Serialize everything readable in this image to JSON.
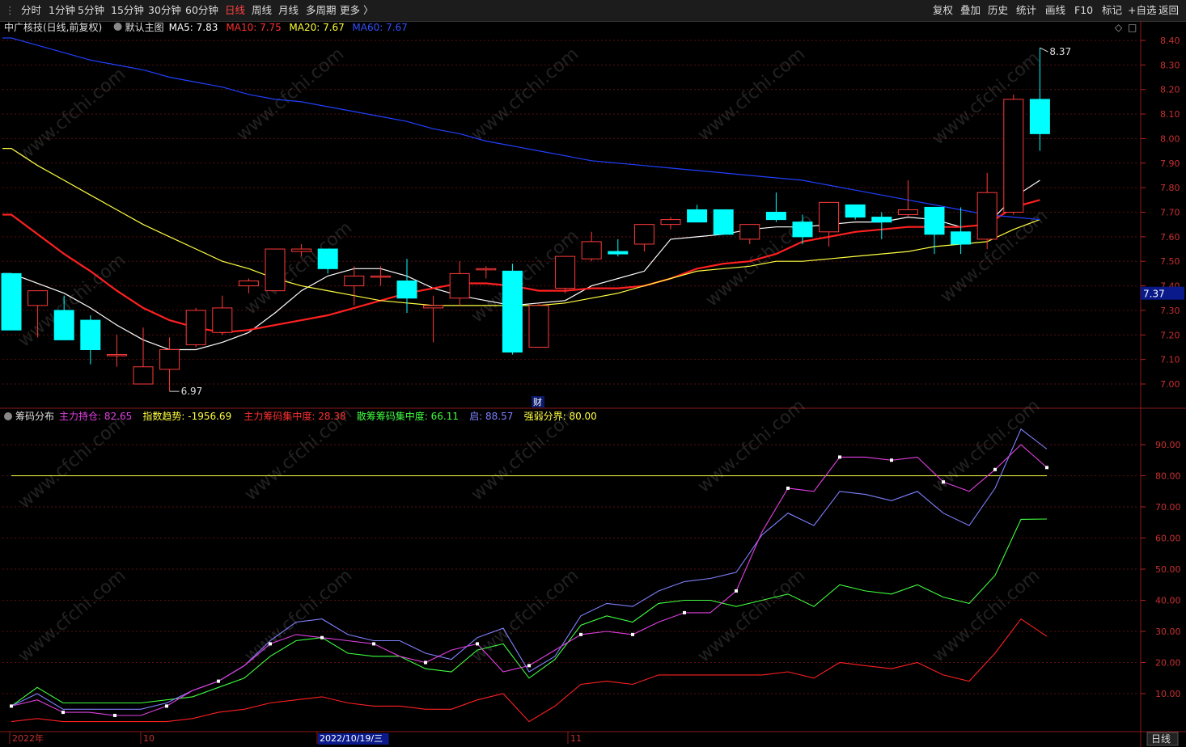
{
  "toolbar": {
    "left": [
      "分时",
      "1分钟",
      "5分钟",
      "15分钟",
      "30分钟",
      "60分钟",
      "日线",
      "周线",
      "月线",
      "多周期",
      "更多 〉"
    ],
    "active": "日线",
    "right": [
      "复权",
      "叠加",
      "历史",
      "统计",
      "画线",
      "F10",
      "标记",
      "+自选",
      "返回"
    ]
  },
  "main_panel": {
    "stock": "中广核技(日线,前复权)",
    "template": "默认主图",
    "ma": [
      {
        "label": "MA5: 7.83",
        "color": "#ffffff"
      },
      {
        "label": "MA10: 7.75",
        "color": "#ff3030"
      },
      {
        "label": "MA20: 7.67",
        "color": "#ffff33"
      },
      {
        "label": "MA60: 7.67",
        "color": "#3050ff"
      }
    ],
    "yticks": [
      "8.40",
      "8.30",
      "8.20",
      "8.10",
      "8.00",
      "7.90",
      "7.80",
      "7.70",
      "7.60",
      "7.50",
      "7.40",
      "7.30",
      "7.20",
      "7.10",
      "7.00"
    ],
    "price_tag": "7.37",
    "high_label": "8.37",
    "low_label": "6.97",
    "cai_marker": "财"
  },
  "indicator_panel": {
    "title": "筹码分布",
    "items": [
      {
        "label": "主力持仓: 82.65",
        "color": "#e040e0"
      },
      {
        "label": "指数趋势: -1956.69",
        "color": "#ffff40"
      },
      {
        "label": "主力筹码集中度: 28.38",
        "color": "#ff3030"
      },
      {
        "label": "散筹筹码集中度: 66.11",
        "color": "#40ff40"
      },
      {
        "label": "启: 88.57",
        "color": "#8080ff"
      },
      {
        "label": "强弱分界: 80.00",
        "color": "#ffff40"
      }
    ],
    "yticks": [
      "90.00",
      "80.00",
      "70.00",
      "60.00",
      "50.00",
      "40.00",
      "30.00",
      "20.00",
      "10.00"
    ]
  },
  "xaxis": {
    "labels": [
      "2022年",
      "10",
      "2022/10/19/三",
      "11"
    ],
    "right_button": "日线"
  },
  "watermark": "www.cfchi.com",
  "chart_data": [
    {
      "type": "candlestick",
      "title": "中广核技(日线,前复权)",
      "ylim": [
        6.92,
        8.45
      ],
      "candles": [
        {
          "o": 7.45,
          "h": 7.45,
          "l": 7.22,
          "c": 7.22
        },
        {
          "o": 7.32,
          "h": 7.36,
          "l": 7.19,
          "c": 7.38
        },
        {
          "o": 7.3,
          "h": 7.36,
          "l": 7.18,
          "c": 7.18
        },
        {
          "o": 7.26,
          "h": 7.28,
          "l": 7.08,
          "c": 7.14
        },
        {
          "o": 7.12,
          "h": 7.2,
          "l": 7.07,
          "c": 7.12
        },
        {
          "o": 7.0,
          "h": 7.23,
          "l": 7.0,
          "c": 7.07
        },
        {
          "o": 7.06,
          "h": 7.19,
          "l": 6.97,
          "c": 7.14
        },
        {
          "o": 7.16,
          "h": 7.31,
          "l": 7.15,
          "c": 7.3
        },
        {
          "o": 7.21,
          "h": 7.36,
          "l": 7.2,
          "c": 7.31
        },
        {
          "o": 7.4,
          "h": 7.43,
          "l": 7.37,
          "c": 7.42
        },
        {
          "o": 7.38,
          "h": 7.54,
          "l": 7.38,
          "c": 7.55
        },
        {
          "o": 7.54,
          "h": 7.57,
          "l": 7.52,
          "c": 7.55
        },
        {
          "o": 7.55,
          "h": 7.55,
          "l": 7.45,
          "c": 7.47
        },
        {
          "o": 7.4,
          "h": 7.48,
          "l": 7.32,
          "c": 7.44
        },
        {
          "o": 7.44,
          "h": 7.48,
          "l": 7.4,
          "c": 7.44
        },
        {
          "o": 7.42,
          "h": 7.51,
          "l": 7.29,
          "c": 7.35
        },
        {
          "o": 7.31,
          "h": 7.36,
          "l": 7.17,
          "c": 7.32
        },
        {
          "o": 7.35,
          "h": 7.5,
          "l": 7.32,
          "c": 7.45
        },
        {
          "o": 7.47,
          "h": 7.48,
          "l": 7.43,
          "c": 7.47
        },
        {
          "o": 7.46,
          "h": 7.49,
          "l": 7.12,
          "c": 7.13
        },
        {
          "o": 7.15,
          "h": 7.33,
          "l": 7.15,
          "c": 7.32
        },
        {
          "o": 7.39,
          "h": 7.52,
          "l": 7.37,
          "c": 7.52
        },
        {
          "o": 7.51,
          "h": 7.62,
          "l": 7.5,
          "c": 7.58
        },
        {
          "o": 7.54,
          "h": 7.59,
          "l": 7.52,
          "c": 7.53
        },
        {
          "o": 7.57,
          "h": 7.65,
          "l": 7.54,
          "c": 7.65
        },
        {
          "o": 7.65,
          "h": 7.68,
          "l": 7.63,
          "c": 7.67
        },
        {
          "o": 7.71,
          "h": 7.73,
          "l": 7.66,
          "c": 7.66
        },
        {
          "o": 7.71,
          "h": 7.71,
          "l": 7.61,
          "c": 7.61
        },
        {
          "o": 7.59,
          "h": 7.65,
          "l": 7.57,
          "c": 7.65
        },
        {
          "o": 7.7,
          "h": 7.78,
          "l": 7.66,
          "c": 7.67
        },
        {
          "o": 7.66,
          "h": 7.69,
          "l": 7.57,
          "c": 7.6
        },
        {
          "o": 7.62,
          "h": 7.74,
          "l": 7.56,
          "c": 7.74
        },
        {
          "o": 7.73,
          "h": 7.73,
          "l": 7.67,
          "c": 7.68
        },
        {
          "o": 7.68,
          "h": 7.7,
          "l": 7.59,
          "c": 7.66
        },
        {
          "o": 7.69,
          "h": 7.83,
          "l": 7.68,
          "c": 7.71
        },
        {
          "o": 7.72,
          "h": 7.72,
          "l": 7.53,
          "c": 7.61
        },
        {
          "o": 7.62,
          "h": 7.72,
          "l": 7.53,
          "c": 7.57
        },
        {
          "o": 7.59,
          "h": 7.86,
          "l": 7.55,
          "c": 7.78
        },
        {
          "o": 7.7,
          "h": 8.18,
          "l": 7.69,
          "c": 8.16
        },
        {
          "o": 8.16,
          "h": 8.37,
          "l": 7.95,
          "c": 8.02
        }
      ],
      "series": [
        {
          "name": "MA5",
          "color": "#ffffff",
          "values": [
            7.45,
            7.41,
            7.37,
            7.31,
            7.24,
            7.18,
            7.14,
            7.14,
            7.17,
            7.21,
            7.29,
            7.38,
            7.44,
            7.47,
            7.47,
            7.44,
            7.39,
            7.36,
            7.34,
            7.32,
            7.33,
            7.34,
            7.4,
            7.43,
            7.46,
            7.59,
            7.6,
            7.61,
            7.63,
            7.64,
            7.64,
            7.65,
            7.66,
            7.66,
            7.68,
            7.67,
            7.64,
            7.65,
            7.76,
            7.83
          ]
        },
        {
          "name": "MA10",
          "color": "#ff2020",
          "values": [
            7.69,
            7.61,
            7.53,
            7.46,
            7.38,
            7.31,
            7.26,
            7.23,
            7.21,
            7.22,
            7.24,
            7.26,
            7.28,
            7.31,
            7.34,
            7.37,
            7.39,
            7.41,
            7.41,
            7.4,
            7.38,
            7.38,
            7.39,
            7.39,
            7.4,
            7.43,
            7.47,
            7.49,
            7.5,
            7.53,
            7.58,
            7.6,
            7.62,
            7.63,
            7.64,
            7.64,
            7.64,
            7.65,
            7.72,
            7.75
          ]
        },
        {
          "name": "MA20",
          "color": "#ffff40",
          "values": [
            7.96,
            7.89,
            7.83,
            7.77,
            7.71,
            7.65,
            7.6,
            7.55,
            7.5,
            7.47,
            7.43,
            7.4,
            7.38,
            7.36,
            7.34,
            7.33,
            7.32,
            7.32,
            7.32,
            7.32,
            7.32,
            7.33,
            7.35,
            7.37,
            7.4,
            7.43,
            7.46,
            7.47,
            7.48,
            7.5,
            7.5,
            7.51,
            7.52,
            7.53,
            7.54,
            7.56,
            7.57,
            7.58,
            7.63,
            7.67
          ]
        },
        {
          "name": "MA60",
          "color": "#2040ff",
          "values": [
            8.41,
            8.38,
            8.35,
            8.32,
            8.3,
            8.28,
            8.25,
            8.23,
            8.21,
            8.18,
            8.16,
            8.15,
            8.13,
            8.11,
            8.09,
            8.07,
            8.04,
            8.02,
            7.99,
            7.97,
            7.95,
            7.93,
            7.91,
            7.9,
            7.89,
            7.88,
            7.87,
            7.86,
            7.85,
            7.84,
            7.83,
            7.81,
            7.79,
            7.77,
            7.75,
            7.73,
            7.71,
            7.69,
            7.68,
            7.67
          ]
        }
      ]
    },
    {
      "type": "line",
      "title": "筹码分布",
      "ylim": [
        0,
        100
      ],
      "reference_line": 80,
      "series": [
        {
          "name": "主力持仓",
          "color": "#e040e0",
          "marked": true,
          "values": [
            6,
            8,
            4,
            4,
            3,
            3,
            6,
            11,
            14,
            19,
            26,
            29,
            28,
            27,
            26,
            22,
            20,
            24,
            26,
            17,
            19,
            24,
            29,
            30,
            29,
            33,
            36,
            36,
            43,
            62,
            76,
            75,
            86,
            86,
            85,
            86,
            78,
            75,
            82,
            90,
            82.65
          ]
        },
        {
          "name": "启",
          "color": "#8080ff",
          "values": [
            6,
            10,
            5,
            5,
            5,
            5,
            7,
            11,
            14,
            19,
            27,
            33,
            34,
            29,
            27,
            27,
            23,
            21,
            28,
            31,
            17,
            22,
            35,
            39,
            38,
            43,
            46,
            47,
            49,
            61,
            68,
            64,
            75,
            74,
            72,
            75,
            68,
            64,
            76,
            95,
            88.57
          ]
        },
        {
          "name": "散筹筹码集中度",
          "color": "#40ff40",
          "values": [
            6,
            12,
            7,
            7,
            7,
            7,
            8,
            9,
            12,
            15,
            22,
            27,
            28,
            23,
            22,
            22,
            18,
            17,
            24,
            26,
            15,
            21,
            32,
            35,
            33,
            39,
            40,
            40,
            38,
            40,
            42,
            38,
            45,
            43,
            42,
            45,
            41,
            39,
            48,
            66,
            66.11
          ]
        },
        {
          "name": "主力筹码集中度",
          "color": "#ff2020",
          "values": [
            1,
            2,
            1,
            1,
            1,
            1,
            1,
            2,
            4,
            5,
            7,
            8,
            9,
            7,
            6,
            6,
            5,
            5,
            8,
            10,
            1,
            6,
            13,
            14,
            13,
            16,
            16,
            16,
            16,
            16,
            17,
            15,
            20,
            19,
            18,
            20,
            16,
            14,
            23,
            34,
            28.38
          ]
        }
      ]
    }
  ]
}
